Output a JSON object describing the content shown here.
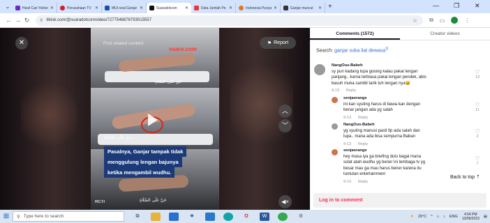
{
  "browser": {
    "tabs": [
      {
        "title": "Hasil Cari Yahoo!",
        "favicon": "yahoo-icon",
        "color": "#6b2cc7"
      },
      {
        "title": "Perusahaan TV",
        "favicon": "opera-icon",
        "color": "#d01f2b"
      },
      {
        "title": "MUI soal Ganjar",
        "favicon": "news-icon",
        "color": "#1b4fa8"
      },
      {
        "title": "Suaradotcom",
        "favicon": "tiktok-icon",
        "color": "#111111",
        "active": true
      },
      {
        "title": "Data Jumlah Pe",
        "favicon": "data-icon",
        "color": "#e53935"
      },
      {
        "title": "Indonesia Punya",
        "favicon": "flower-icon",
        "color": "#e07a1c"
      },
      {
        "title": "Ganjar muncul",
        "favicon": "video-icon",
        "color": "#333333"
      }
    ],
    "url": "tiktok.com/@suaradotcom/video/7277546876793015557"
  },
  "video": {
    "find_related": "Find related content",
    "watermark": "suara.com",
    "report_label": "Report",
    "caption_lines": [
      "Pasalnya, Ganjar tampak tidak",
      "menggulung lengan bajunya",
      "ketika mengambil wudhu."
    ],
    "arabic_top": "حَيَّ عَلَى الصَّلَاةِ",
    "arabic_mid": "حَيَّ عَلَى الصَّلَاةِ",
    "arabic_bottom": "حَيَّ عَلَى الصَّلَاةِ",
    "channel": "RCTI"
  },
  "comments": {
    "tab_comments": "Comments (1572)",
    "tab_creator": "Creator videos",
    "search_prefix": "Search:",
    "search_query": "ganjar suka liat dewasa",
    "items": [
      {
        "user": "NangOus-Babeh",
        "lines": [
          "sy pun kadang lupa gulung kalau pakai lengan",
          "panjang.. karna terbiasa pakai lengan pendek, abis",
          "basuh muka sambil tarik tuh lengan nya😄"
        ],
        "date": "9-13",
        "reply": "Reply",
        "likes": "13"
      },
      {
        "user": "senjaorange",
        "lines": [
          "ini kan syuting harus di bawa kan dengan",
          "benar jangan ada yg salah"
        ],
        "date": "9-13",
        "reply": "Reply",
        "likes": "11"
      },
      {
        "user": "NangOus-Babeh",
        "lines": [
          "yg syuting manusi pasti tlp ada salah dan",
          "lupa.. mana ada bisa sempurna Baban"
        ],
        "date": "9-13",
        "reply": "Reply",
        "likes": "2"
      },
      {
        "user": "senjaorange",
        "lines": [
          "hey masa iya ga briefing dulu bagai mana",
          "solat atah wudhu yg bener ini lembaga tv yg",
          "besar mau ga mau harus bener karena itu",
          "tuntutan entertainment"
        ],
        "date": "9-13",
        "reply": "Reply",
        "likes": "7"
      }
    ],
    "back_to_top": "Back to top",
    "login_label": "Log in to comment"
  },
  "taskbar": {
    "search_placeholder": "Type here to search",
    "temperature": "29°C",
    "lang": "ENG",
    "time": "4:54 PM",
    "date": "13/09/2023"
  }
}
